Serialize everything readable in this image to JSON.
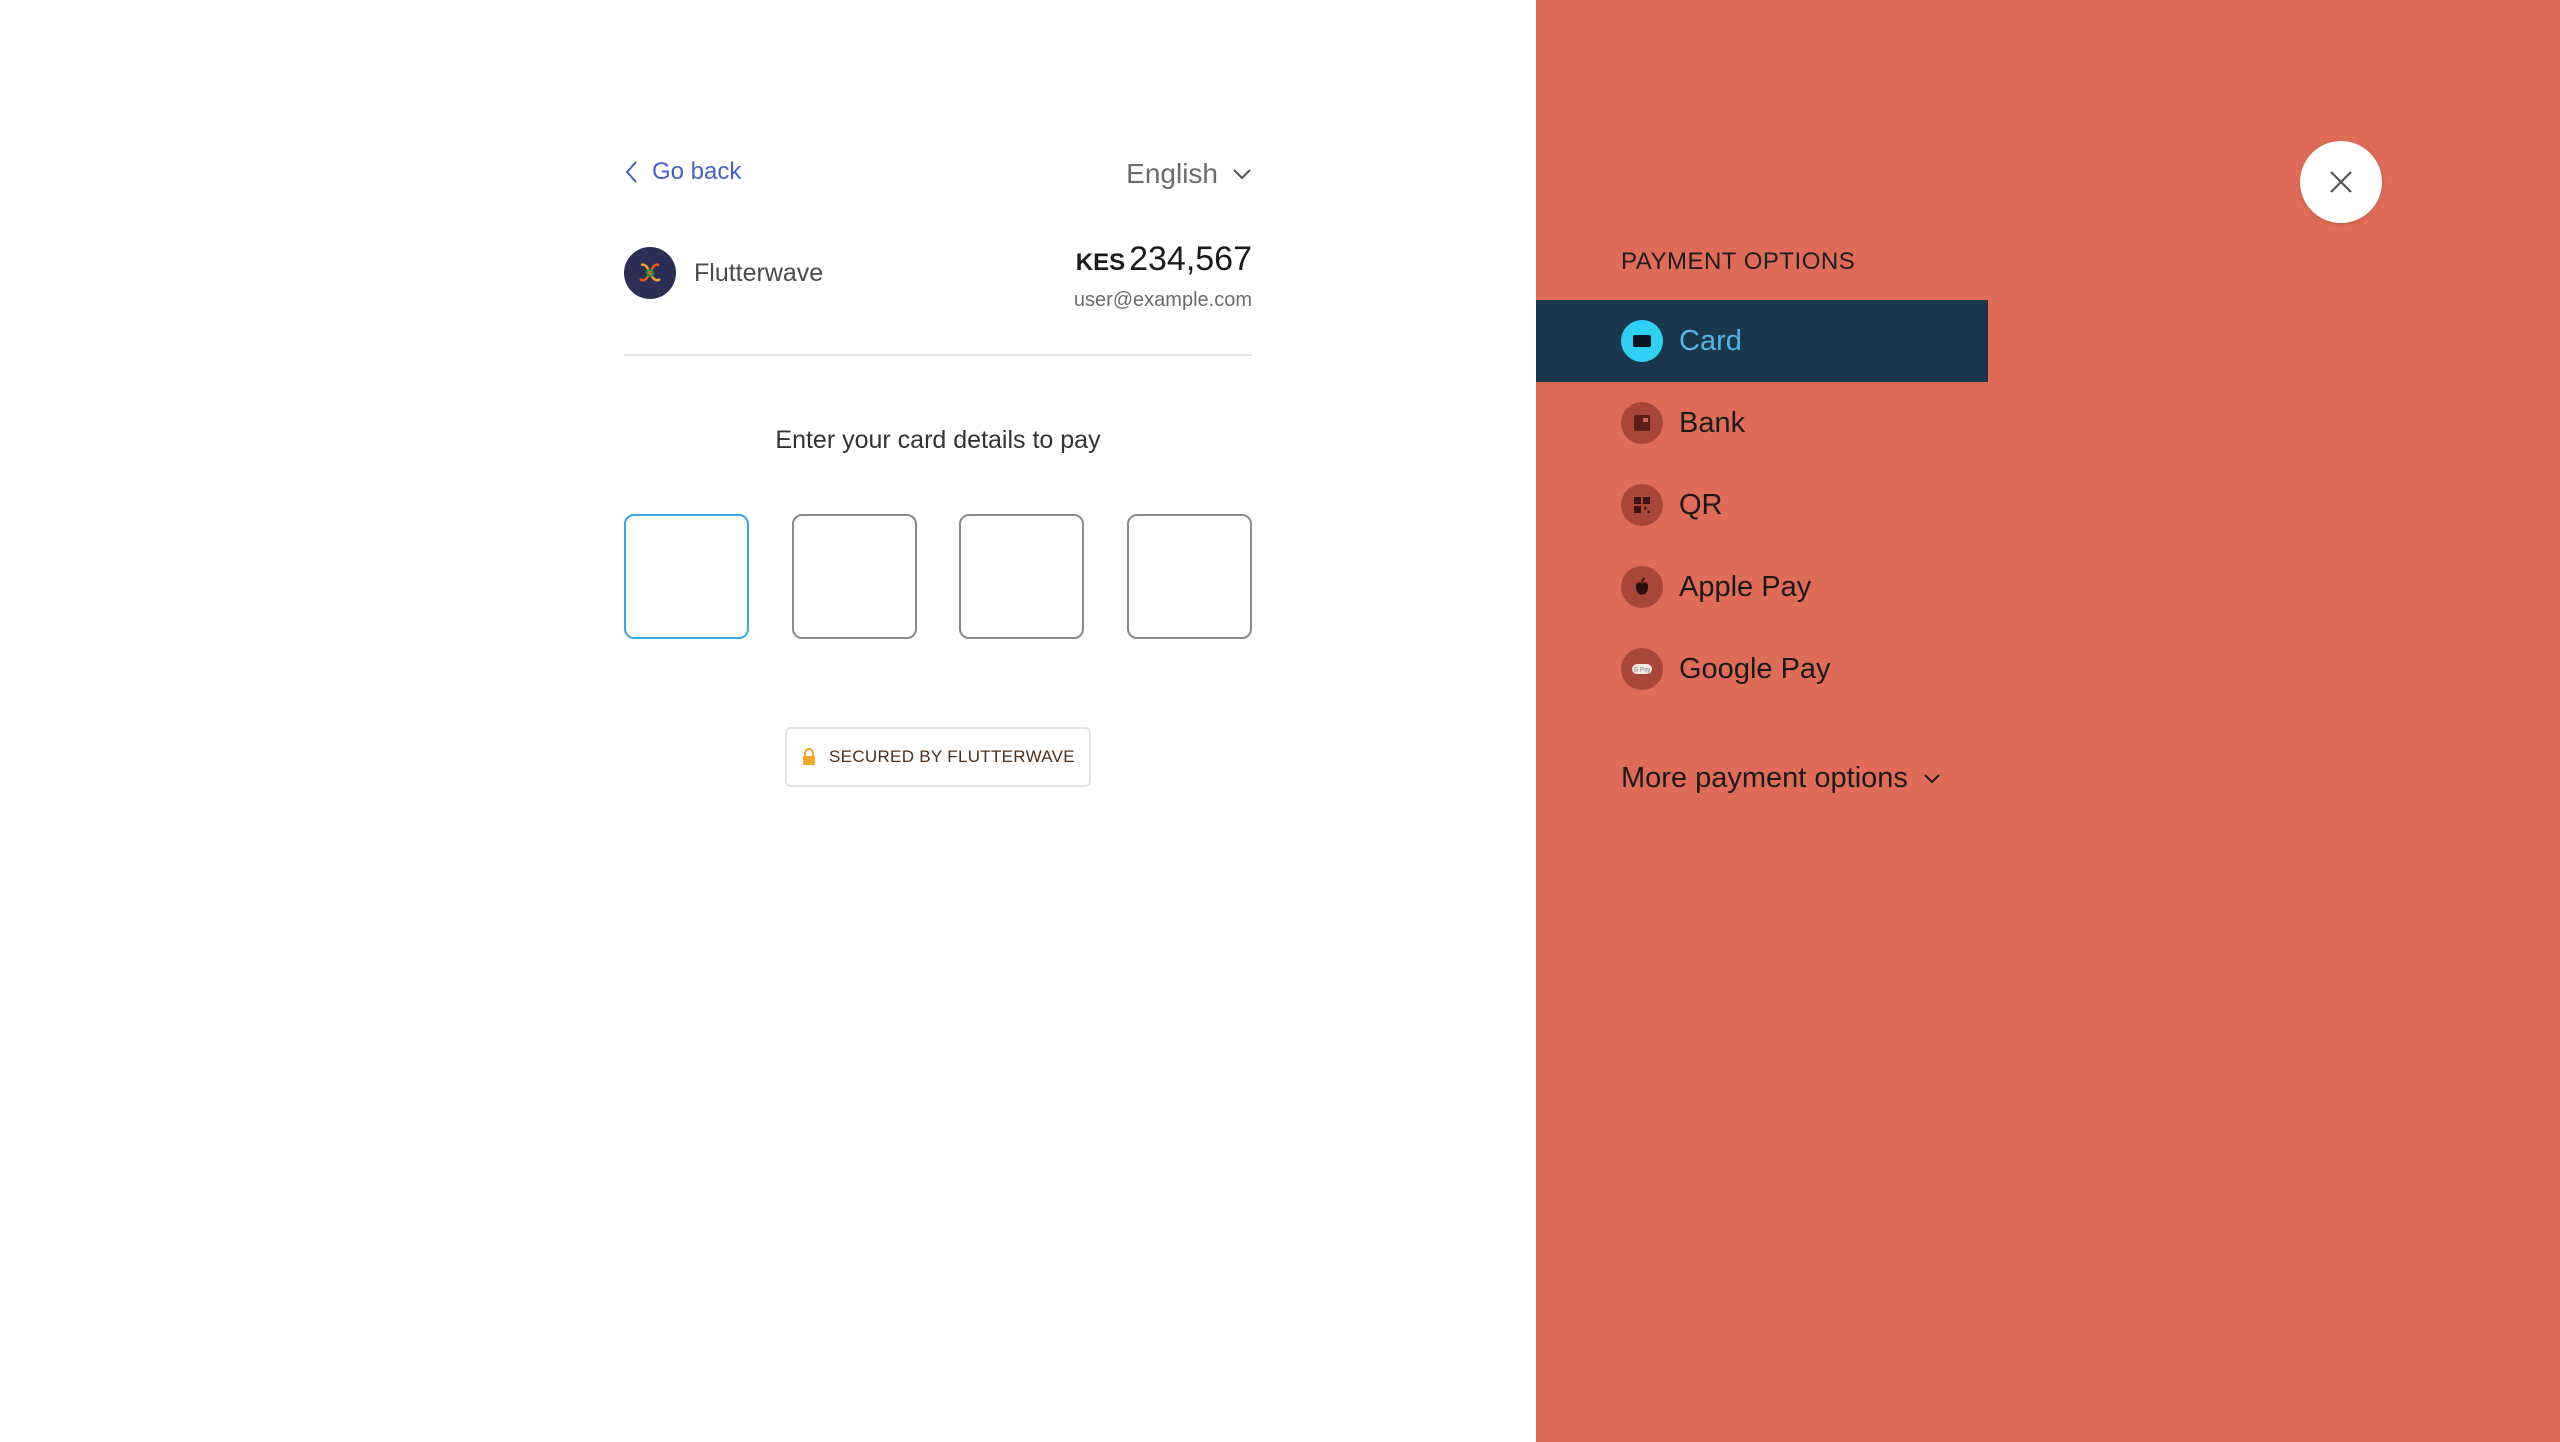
{
  "nav": {
    "go_back_label": "Go back",
    "language": "English"
  },
  "merchant": {
    "name": "Flutterwave"
  },
  "payment": {
    "currency": "KES",
    "amount": "234,567",
    "email": "user@example.com"
  },
  "form": {
    "prompt": "Enter your card details to pay",
    "pin_boxes": [
      "",
      "",
      "",
      ""
    ]
  },
  "secured_label": "SECURED BY FLUTTERWAVE",
  "options_panel": {
    "title": "PAYMENT OPTIONS",
    "items": [
      {
        "label": "Card",
        "icon": "card-icon",
        "active": true
      },
      {
        "label": "Bank",
        "icon": "bank-icon",
        "active": false
      },
      {
        "label": "QR",
        "icon": "qr-icon",
        "active": false
      },
      {
        "label": "Apple Pay",
        "icon": "apple-icon",
        "active": false
      },
      {
        "label": "Google Pay",
        "icon": "google-pay-icon",
        "active": false
      }
    ],
    "more_label": "More payment options"
  },
  "colors": {
    "panel_bg": "#df6b58",
    "active_item_bg": "#1b374b",
    "active_item_text": "#53b4e6",
    "link": "#4a5fc1",
    "focus_border": "#3aa7e0"
  }
}
